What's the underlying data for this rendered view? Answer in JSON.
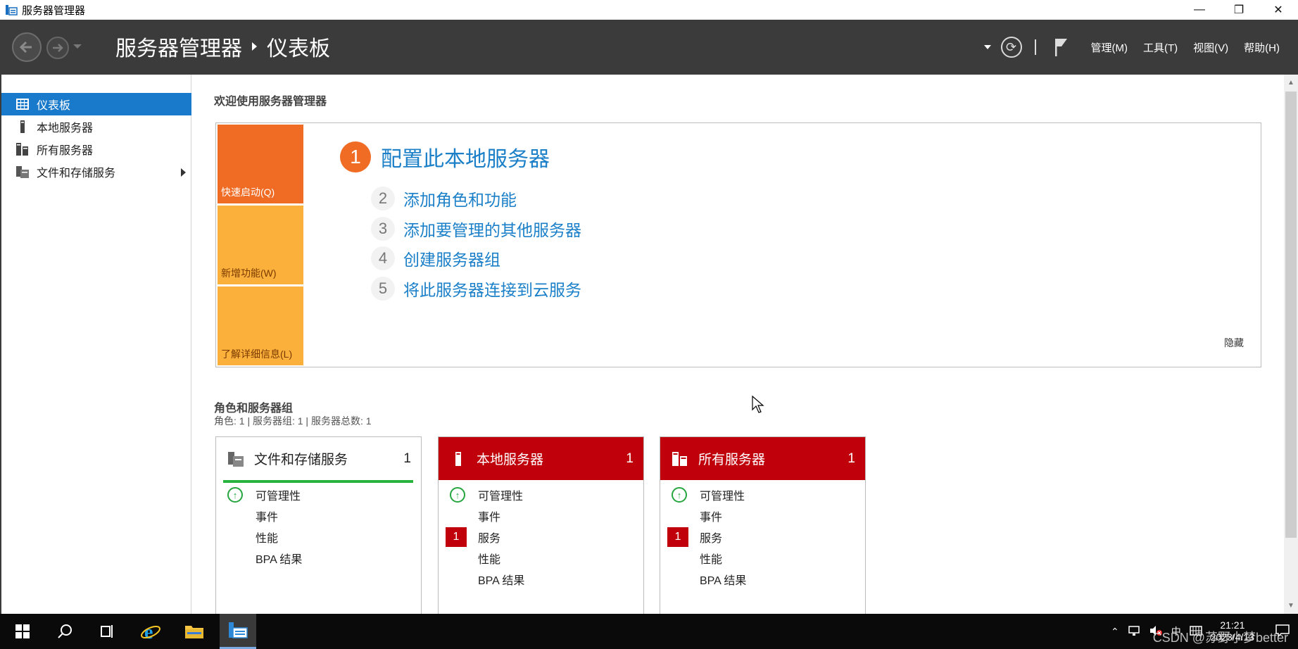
{
  "window": {
    "title": "服务器管理器",
    "minimize": "—",
    "restore": "❐",
    "close": "✕"
  },
  "header": {
    "breadcrumb_root": "服务器管理器",
    "breadcrumb_current": "仪表板",
    "refresh_icon": "⟳",
    "menus": [
      "管理(M)",
      "工具(T)",
      "视图(V)",
      "帮助(H)"
    ]
  },
  "sidebar": {
    "items": [
      {
        "label": "仪表板",
        "icon": "dashboard-icon",
        "active": true
      },
      {
        "label": "本地服务器",
        "icon": "server-icon",
        "active": false
      },
      {
        "label": "所有服务器",
        "icon": "servers-icon",
        "active": false
      },
      {
        "label": "文件和存储服务",
        "icon": "file-storage-icon",
        "active": false
      }
    ]
  },
  "main": {
    "welcome_title": "欢迎使用服务器管理器",
    "tiles": [
      "快速启动(Q)",
      "新增功能(W)",
      "了解详细信息(L)"
    ],
    "steps": [
      {
        "num": "1",
        "label": "配置此本地服务器"
      },
      {
        "num": "2",
        "label": "添加角色和功能"
      },
      {
        "num": "3",
        "label": "添加要管理的其他服务器"
      },
      {
        "num": "4",
        "label": "创建服务器组"
      },
      {
        "num": "5",
        "label": "将此服务器连接到云服务"
      }
    ],
    "hide_label": "隐藏",
    "roles_title": "角色和服务器组",
    "roles_summary": "角色: 1 | 服务器组: 1 | 服务器总数: 1",
    "cards": [
      {
        "title": "文件和存储服务",
        "count": "1",
        "rows": [
          {
            "label": "可管理性",
            "status": "ok"
          },
          {
            "label": "事件",
            "status": ""
          },
          {
            "label": "性能",
            "status": ""
          },
          {
            "label": "BPA 结果",
            "status": ""
          }
        ]
      },
      {
        "title": "本地服务器",
        "count": "1",
        "rows": [
          {
            "label": "可管理性",
            "status": "ok"
          },
          {
            "label": "事件",
            "status": ""
          },
          {
            "label": "服务",
            "status": "1"
          },
          {
            "label": "性能",
            "status": ""
          },
          {
            "label": "BPA 结果",
            "status": ""
          }
        ]
      },
      {
        "title": "所有服务器",
        "count": "1",
        "rows": [
          {
            "label": "可管理性",
            "status": "ok"
          },
          {
            "label": "事件",
            "status": ""
          },
          {
            "label": "服务",
            "status": "1"
          },
          {
            "label": "性能",
            "status": ""
          },
          {
            "label": "BPA 结果",
            "status": ""
          }
        ]
      }
    ]
  },
  "taskbar": {
    "items": [
      "start-icon",
      "search-icon",
      "task-view-icon",
      "ie-icon",
      "file-explorer-icon",
      "server-manager-icon"
    ],
    "tray": {
      "ime": "中",
      "time": "21:21",
      "date": "2023/4/13"
    },
    "watermark": "CSDN @苏野小梦better"
  },
  "colors": {
    "accent_blue": "#1979ca",
    "link_blue": "#1b80c8",
    "orange": "#f06b23",
    "light_orange": "#fbb03b",
    "alert_red": "#c0000a",
    "ok_green": "#27b33d",
    "header_bg": "#3b3b3b"
  }
}
